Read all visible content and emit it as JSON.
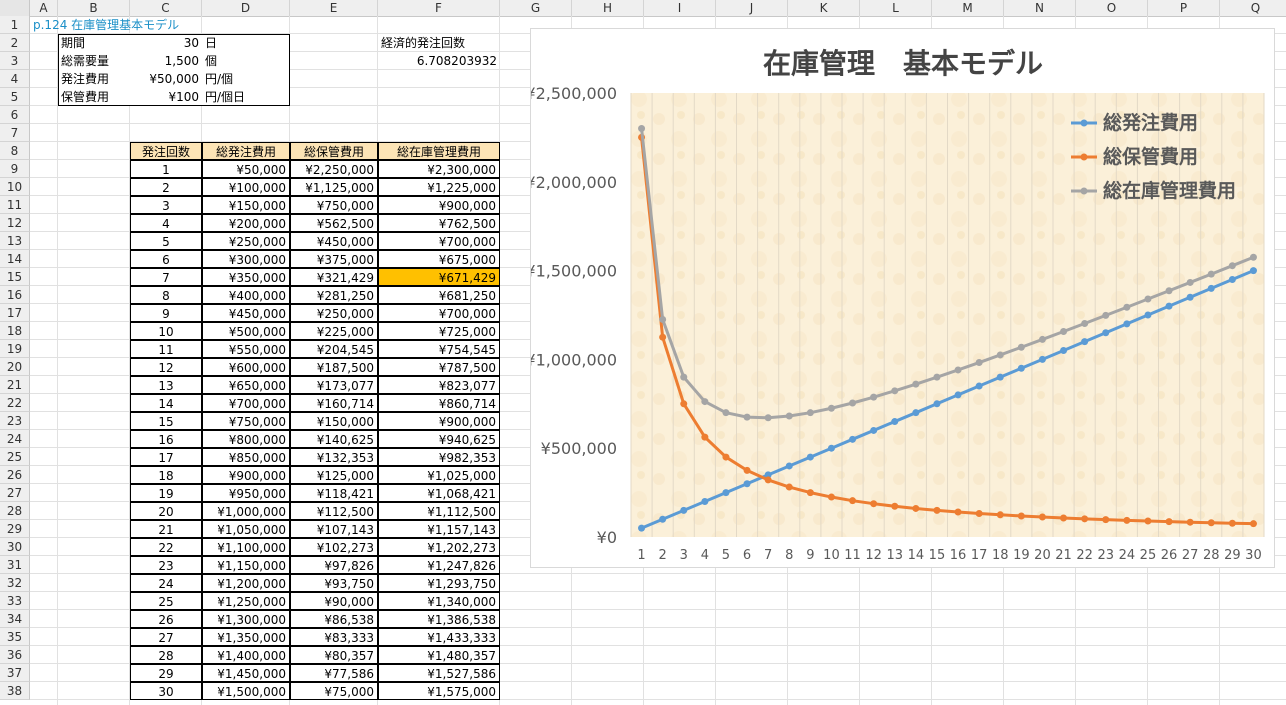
{
  "columns": [
    "A",
    "B",
    "C",
    "D",
    "E",
    "F",
    "G",
    "H",
    "I",
    "J",
    "K",
    "L",
    "M",
    "N",
    "O",
    "P",
    "Q"
  ],
  "rows": [
    1,
    2,
    3,
    4,
    5,
    6,
    7,
    8,
    9,
    10,
    11,
    12,
    13,
    14,
    15,
    16,
    17,
    18,
    19,
    20,
    21,
    22,
    23,
    24,
    25,
    26,
    27,
    28,
    29,
    30,
    31,
    32,
    33,
    34,
    35,
    36,
    37,
    38
  ],
  "title_link": "p.124 在庫管理基本モデル",
  "params": [
    {
      "label": "期間",
      "value": "30",
      "unit": "日"
    },
    {
      "label": "総需要量",
      "value": "1,500",
      "unit": "個"
    },
    {
      "label": "発注費用",
      "value": "¥50,000",
      "unit": "円/個"
    },
    {
      "label": "保管費用",
      "value": "¥100",
      "unit": "円/個日"
    }
  ],
  "eoq": {
    "label": "経済的発注回数",
    "value": "6.708203932"
  },
  "table_headers": [
    "発注回数",
    "総発注費用",
    "総保管費用",
    "総在庫管理費用"
  ],
  "table_rows": [
    [
      "1",
      "¥50,000",
      "¥2,250,000",
      "¥2,300,000"
    ],
    [
      "2",
      "¥100,000",
      "¥1,125,000",
      "¥1,225,000"
    ],
    [
      "3",
      "¥150,000",
      "¥750,000",
      "¥900,000"
    ],
    [
      "4",
      "¥200,000",
      "¥562,500",
      "¥762,500"
    ],
    [
      "5",
      "¥250,000",
      "¥450,000",
      "¥700,000"
    ],
    [
      "6",
      "¥300,000",
      "¥375,000",
      "¥675,000"
    ],
    [
      "7",
      "¥350,000",
      "¥321,429",
      "¥671,429"
    ],
    [
      "8",
      "¥400,000",
      "¥281,250",
      "¥681,250"
    ],
    [
      "9",
      "¥450,000",
      "¥250,000",
      "¥700,000"
    ],
    [
      "10",
      "¥500,000",
      "¥225,000",
      "¥725,000"
    ],
    [
      "11",
      "¥550,000",
      "¥204,545",
      "¥754,545"
    ],
    [
      "12",
      "¥600,000",
      "¥187,500",
      "¥787,500"
    ],
    [
      "13",
      "¥650,000",
      "¥173,077",
      "¥823,077"
    ],
    [
      "14",
      "¥700,000",
      "¥160,714",
      "¥860,714"
    ],
    [
      "15",
      "¥750,000",
      "¥150,000",
      "¥900,000"
    ],
    [
      "16",
      "¥800,000",
      "¥140,625",
      "¥940,625"
    ],
    [
      "17",
      "¥850,000",
      "¥132,353",
      "¥982,353"
    ],
    [
      "18",
      "¥900,000",
      "¥125,000",
      "¥1,025,000"
    ],
    [
      "19",
      "¥950,000",
      "¥118,421",
      "¥1,068,421"
    ],
    [
      "20",
      "¥1,000,000",
      "¥112,500",
      "¥1,112,500"
    ],
    [
      "21",
      "¥1,050,000",
      "¥107,143",
      "¥1,157,143"
    ],
    [
      "22",
      "¥1,100,000",
      "¥102,273",
      "¥1,202,273"
    ],
    [
      "23",
      "¥1,150,000",
      "¥97,826",
      "¥1,247,826"
    ],
    [
      "24",
      "¥1,200,000",
      "¥93,750",
      "¥1,293,750"
    ],
    [
      "25",
      "¥1,250,000",
      "¥90,000",
      "¥1,340,000"
    ],
    [
      "26",
      "¥1,300,000",
      "¥86,538",
      "¥1,386,538"
    ],
    [
      "27",
      "¥1,350,000",
      "¥83,333",
      "¥1,433,333"
    ],
    [
      "28",
      "¥1,400,000",
      "¥80,357",
      "¥1,480,357"
    ],
    [
      "29",
      "¥1,450,000",
      "¥77,586",
      "¥1,527,586"
    ],
    [
      "30",
      "¥1,500,000",
      "¥75,000",
      "¥1,575,000"
    ]
  ],
  "highlight_row": 7,
  "highlight_color": "#ffc000",
  "chart_data": {
    "type": "line",
    "title": "在庫管理　基本モデル",
    "x": [
      1,
      2,
      3,
      4,
      5,
      6,
      7,
      8,
      9,
      10,
      11,
      12,
      13,
      14,
      15,
      16,
      17,
      18,
      19,
      20,
      21,
      22,
      23,
      24,
      25,
      26,
      27,
      28,
      29,
      30
    ],
    "ylim": [
      0,
      2500000
    ],
    "yticks": [
      "¥0",
      "¥500,000",
      "¥1,000,000",
      "¥1,500,000",
      "¥2,000,000",
      "¥2,500,000"
    ],
    "ytick_values": [
      0,
      500000,
      1000000,
      1500000,
      2000000,
      2500000
    ],
    "legend_position": "top-right",
    "plot_background": "#fbf0d9",
    "series": [
      {
        "name": "総発注費用",
        "color": "#5b9bd5",
        "values": [
          50000,
          100000,
          150000,
          200000,
          250000,
          300000,
          350000,
          400000,
          450000,
          500000,
          550000,
          600000,
          650000,
          700000,
          750000,
          800000,
          850000,
          900000,
          950000,
          1000000,
          1050000,
          1100000,
          1150000,
          1200000,
          1250000,
          1300000,
          1350000,
          1400000,
          1450000,
          1500000
        ]
      },
      {
        "name": "総保管費用",
        "color": "#ed7d31",
        "values": [
          2250000,
          1125000,
          750000,
          562500,
          450000,
          375000,
          321429,
          281250,
          250000,
          225000,
          204545,
          187500,
          173077,
          160714,
          150000,
          140625,
          132353,
          125000,
          118421,
          112500,
          107143,
          102273,
          97826,
          93750,
          90000,
          86538,
          83333,
          80357,
          77586,
          75000
        ]
      },
      {
        "name": "総在庫管理費用",
        "color": "#a5a5a5",
        "values": [
          2300000,
          1225000,
          900000,
          762500,
          700000,
          675000,
          671429,
          681250,
          700000,
          725000,
          754545,
          787500,
          823077,
          860714,
          900000,
          940625,
          982353,
          1025000,
          1068421,
          1112500,
          1157143,
          1202273,
          1247826,
          1293750,
          1340000,
          1386538,
          1433333,
          1480357,
          1527586,
          1575000
        ]
      }
    ]
  }
}
